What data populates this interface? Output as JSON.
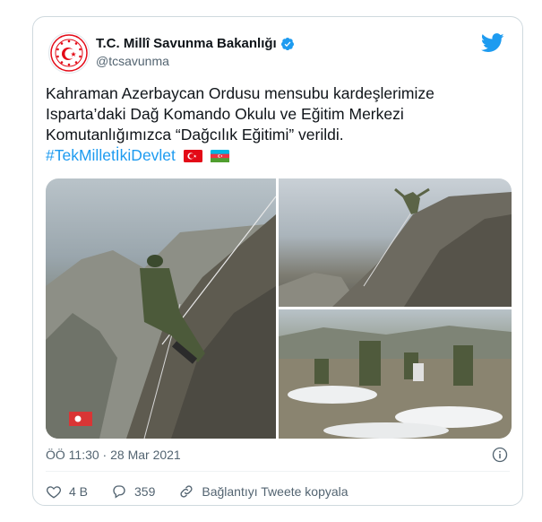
{
  "tweet": {
    "display_name": "T.C. Millî Savunma Bakanlığı",
    "handle": "@tcsavunma",
    "text_lines": [
      "Kahraman Azerbaycan Ordusu mensubu kardeşlerimize",
      "Isparta’daki Dağ Komando Okulu ve Eğitim Merkezi",
      "Komutanlığımızca “Dağcılık Eğitimi” verildi."
    ],
    "hashtag": "#TekMilletİkiDevlet",
    "timestamp": "ÖÖ 11:30 · 28 Mar 2021"
  },
  "actions": {
    "likes": "4 B",
    "replies": "359",
    "copy_link": "Bağlantıyı Tweete kopyala"
  },
  "icons": {
    "avatar": "mod-emblem-icon",
    "verified": "verified-badge-icon",
    "brand": "twitter-bird-icon",
    "info": "info-icon",
    "like": "heart-icon",
    "reply": "reply-bubble-icon",
    "link": "link-icon"
  },
  "colors": {
    "accent": "#1d9bf0",
    "muted": "#536471",
    "border": "#cfd9de",
    "emblem_red": "#e30a17"
  }
}
